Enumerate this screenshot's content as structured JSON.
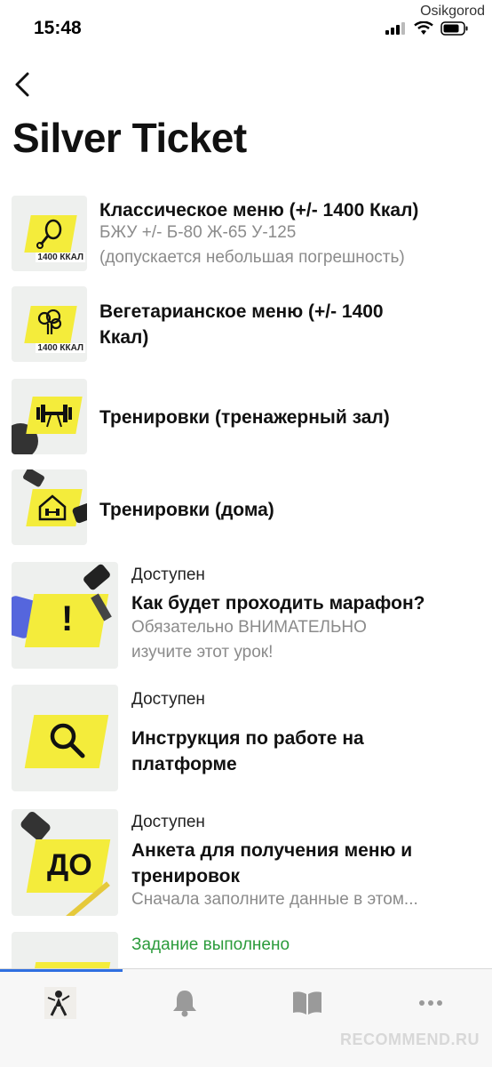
{
  "status_bar": {
    "time": "15:48",
    "carrier_watermark": "Osikgorod"
  },
  "header": {
    "title": "Silver Ticket"
  },
  "items": [
    {
      "title": "Классическое меню (+/- 1400 Ккал)",
      "sub1": "БЖУ +/- Б-80 Ж-65 У-125",
      "sub2": "(допускается небольшая погрешность)",
      "kcal": "1400 ККАЛ"
    },
    {
      "title1": "Вегетарианское меню (+/- 1400",
      "title2": "Ккал)",
      "kcal": "1400 ККАЛ"
    },
    {
      "title": "Тренировки (тренажерный зал)"
    },
    {
      "title": "Тренировки (дома)"
    },
    {
      "status": "Доступен",
      "title": "Как будет проходить марафон?",
      "sub1": "Обязательно ВНИМАТЕЛЬНО",
      "sub2": "изучите этот урок!"
    },
    {
      "status": "Доступен",
      "title1": "Инструкция по работе на",
      "title2": "платформе"
    },
    {
      "status": "Доступен",
      "title1": "Анкета для получения меню и",
      "title2": "тренировок",
      "sub1": "Сначала заполните данные в этом...",
      "badge": "ДО"
    },
    {
      "status": "Задание выполнено"
    }
  ],
  "icons": {
    "back": "chevron-left-icon",
    "tabs": [
      "avatar",
      "bell-icon",
      "book-icon",
      "more-icon"
    ]
  },
  "colors": {
    "accent": "#2f6fe0",
    "done": "#2b9b3b",
    "sticker": "#f4ec3b"
  },
  "watermark": "RECOMMEND.RU"
}
